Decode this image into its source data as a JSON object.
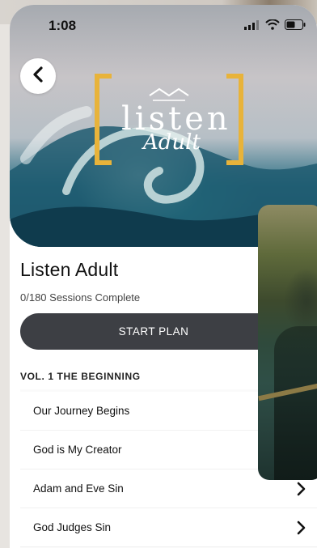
{
  "status_bar": {
    "time": "1:08"
  },
  "hero": {
    "logo_word": "listen",
    "logo_script": "Adult"
  },
  "plan": {
    "title": "Listen Adult",
    "progress_text": "0/180 Sessions Complete",
    "start_label": "START PLAN"
  },
  "volume": {
    "title": "VOL. 1 THE BEGINNING",
    "sessions": [
      {
        "label": "Our Journey Begins"
      },
      {
        "label": "God is My Creator"
      },
      {
        "label": "Adam and Eve Sin"
      },
      {
        "label": "God Judges Sin"
      }
    ]
  },
  "colors": {
    "accent_gold": "#e8b33a",
    "button_dark": "#3d3f44"
  }
}
